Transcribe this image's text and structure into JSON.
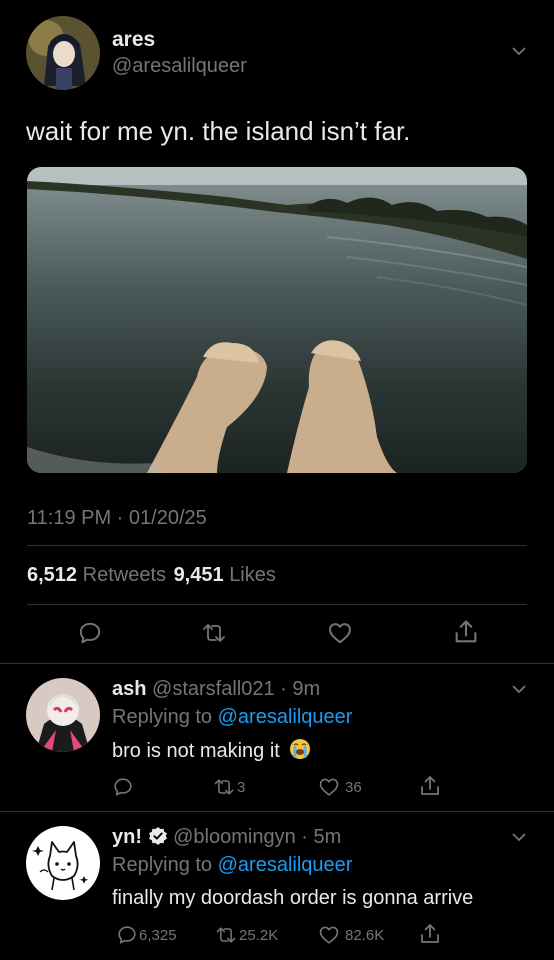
{
  "main_tweet": {
    "display_name": "ares",
    "handle": "@aresalilqueer",
    "text": "wait for me yn. the island isn’t far.",
    "timestamp": "11:19 PM · 01/20/25",
    "retweets_count": "6,512",
    "retweets_label": "Retweets",
    "likes_count": "9,451",
    "likes_label": "Likes",
    "icons": [
      "reply-icon",
      "retweet-icon",
      "like-icon",
      "share-icon"
    ]
  },
  "replies": [
    {
      "display_name": "ash",
      "meta": "@starsfall021 · 9m",
      "replying_prefix": "Replying to",
      "replying_handle": "@aresalilqueer",
      "text": "bro is not making it",
      "emoji": "😭",
      "reply_count": "",
      "retweet_count": "3",
      "like_count": "36"
    },
    {
      "display_name": "yn!",
      "verified": true,
      "meta": "@bloomingyn · 5m",
      "replying_prefix": "Replying to",
      "replying_handle": "@aresalilqueer",
      "text": "finally my doordash order is gonna arrive",
      "reply_count": "6,325",
      "retweet_count": "25.2K",
      "like_count": "82.6K"
    }
  ],
  "colors": {
    "background": "#000000",
    "text": "#e7e9ea",
    "secondary": "#71767b",
    "link": "#1d9bf0",
    "divider": "#2f3336"
  }
}
